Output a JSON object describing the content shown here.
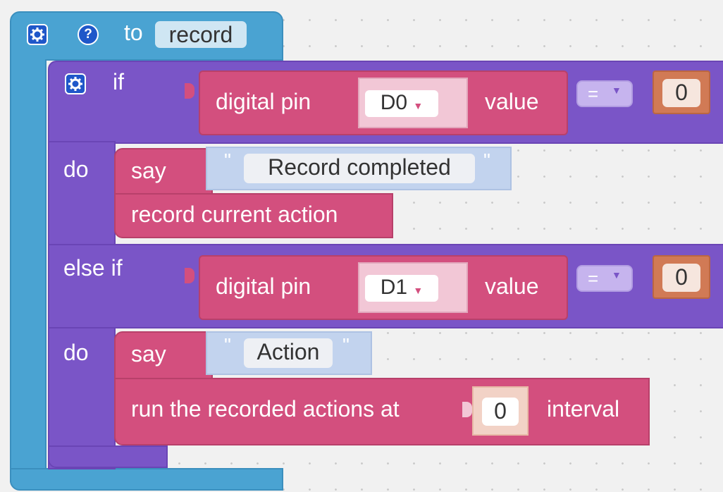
{
  "procedure": {
    "to_label": "to",
    "name": "record",
    "help_label": "?"
  },
  "if_block": {
    "if_label": "if",
    "do_label": "do",
    "else_if_label": "else if",
    "do2_label": "do"
  },
  "conditions": [
    {
      "sensor_label": "digital pin",
      "pin": "D0",
      "value_label": "value",
      "operator": "=",
      "compare_value": "0"
    },
    {
      "sensor_label": "digital pin",
      "pin": "D1",
      "value_label": "value",
      "operator": "=",
      "compare_value": "0"
    }
  ],
  "do_branch": {
    "say_label": "say",
    "say_text": "Record completed",
    "quote_open": "\"",
    "quote_close": "\"",
    "action_label": "record current action"
  },
  "else_branch": {
    "say_label": "say",
    "say_text": "Action",
    "quote_open": "\"",
    "quote_close": "\"",
    "run_label": "run the recorded actions at",
    "interval_value": "0",
    "interval_label": "interval"
  },
  "colors": {
    "procedure": "#4aa3d2",
    "control": "#7a55c7",
    "action": "#d34f7e",
    "text": "#c2d3ee",
    "number": "#d17a55"
  }
}
